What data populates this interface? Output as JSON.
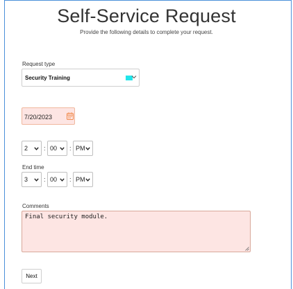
{
  "header": {
    "title": "Self-Service Request",
    "subtitle": "Provide the following details to complete your request."
  },
  "request_type": {
    "label": "Request type",
    "value": "Security Training",
    "swatch_color": "#22e5ea"
  },
  "date": {
    "value": "7/20/2023",
    "icon": "calendar-icon",
    "accent_color": "#f08a4b"
  },
  "start_time": {
    "hour": "2",
    "minute": "00",
    "ampm": "PM"
  },
  "end_time": {
    "label": "End time",
    "hour": "3",
    "minute": "00",
    "ampm": "PM"
  },
  "comments": {
    "label": "Comments",
    "value": "Final security module."
  },
  "actions": {
    "next_label": "Next"
  },
  "time_separator": ":"
}
